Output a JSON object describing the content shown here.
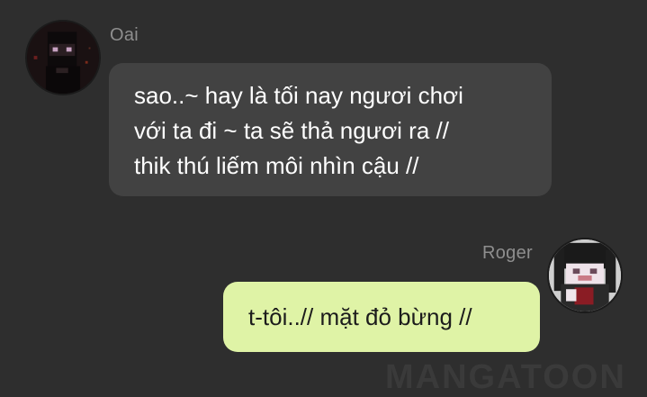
{
  "messages": [
    {
      "sender": "Oai",
      "lines": [
        "sao..~ hay là tối nay ngươi chơi",
        "với ta đi ~ ta sẽ thả ngươi ra //",
        "thik thú liếm môi nhìn cậu //"
      ]
    },
    {
      "sender": "Roger",
      "text": "t-tôi..// mặt đỏ bừng //"
    }
  ],
  "watermark": "MANGATOON",
  "colors": {
    "background": "#2e2e2e",
    "incoming_bubble": "#424242",
    "outgoing_bubble": "#dff3a6",
    "name_text": "#8e8e8e"
  }
}
